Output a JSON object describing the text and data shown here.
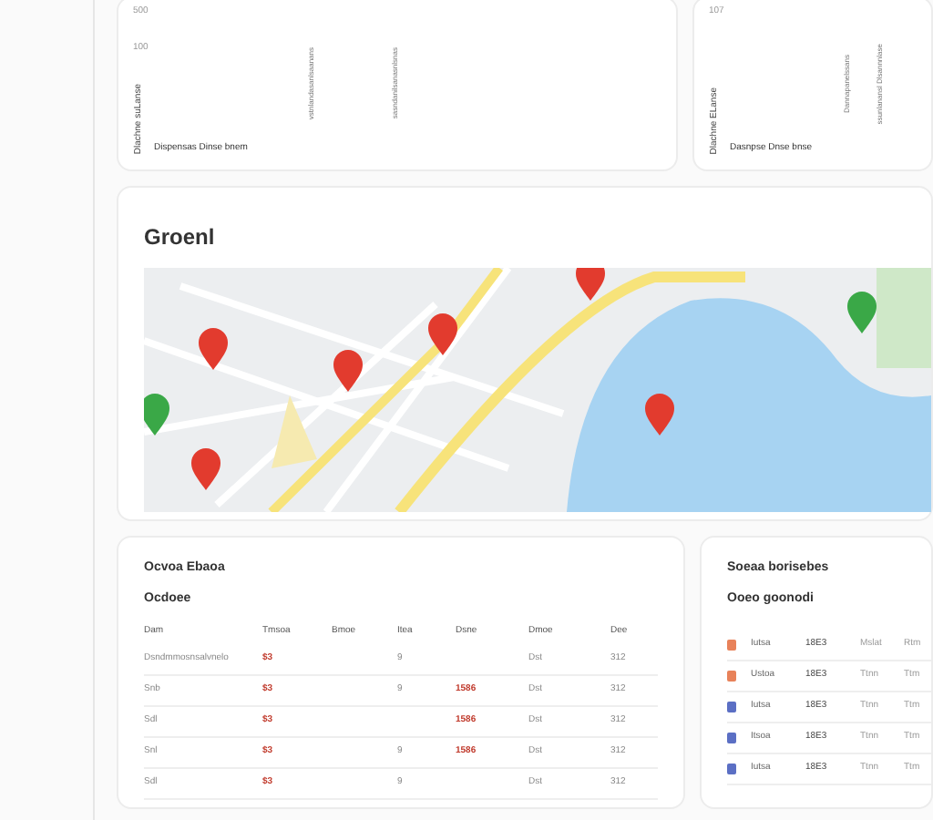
{
  "top_panels": [
    {
      "ticks": [
        "500",
        "100"
      ],
      "axis_label": "Dlachne suLanse",
      "bar_labels": [
        "vstnlandasanlsaanans",
        "sasndanilsanasnlsnas"
      ],
      "caption": "Dispensas Dinse bnem"
    },
    {
      "ticks": [
        "107"
      ],
      "axis_label": "Dlachne ELanse",
      "bar_labels": [
        "Dannapanelssans",
        "ssunlanansl Dlsannnlase"
      ],
      "caption": "Dasnpse Dnse bnse"
    }
  ],
  "map_panel": {
    "title": "Groenl"
  },
  "table_panel": {
    "title": "Ocvoa Ebaoa",
    "subtitle": "Ocdoee",
    "columns": [
      "Dam",
      "Tmsoa",
      "Bmoe",
      "Itea",
      "Dsne",
      "Dmoe",
      "Dee"
    ],
    "rows": [
      [
        "Dsndmmosnsalvnelo",
        "$3",
        "",
        "9",
        "",
        "Dst",
        "312"
      ],
      [
        "Snb",
        "$3",
        "",
        "9",
        "1586",
        "Dst",
        "312"
      ],
      [
        "Sdl",
        "$3",
        "",
        "",
        "1586",
        "Dst",
        "312"
      ],
      [
        "Snl",
        "$3",
        "",
        "9",
        "1586",
        "Dst",
        "312"
      ],
      [
        "Sdl",
        "$3",
        "",
        "9",
        "",
        "Dst",
        "312"
      ]
    ]
  },
  "side_panel": {
    "title": "Soeaa borisebes",
    "subtitle": "Ooeo goonodi",
    "rows": [
      {
        "color": "#e8825a",
        "name": "Iutsa",
        "value": "18E3",
        "col_3": "Mslat",
        "col_4": "Rtm"
      },
      {
        "color": "#e8825a",
        "name": "Ustoa",
        "value": "18E3",
        "col_3": "Ttnn",
        "col_4": "Ttm"
      },
      {
        "color": "#5b6fc4",
        "name": "Iutsa",
        "value": "18E3",
        "col_3": "Ttnn",
        "col_4": "Ttm"
      },
      {
        "color": "#5b6fc4",
        "name": "Itsoa",
        "value": "18E3",
        "col_3": "Ttnn",
        "col_4": "Ttm"
      },
      {
        "color": "#5b6fc4",
        "name": "Iutsa",
        "value": "18E3",
        "col_3": "Ttnn",
        "col_4": "Ttm"
      }
    ]
  }
}
